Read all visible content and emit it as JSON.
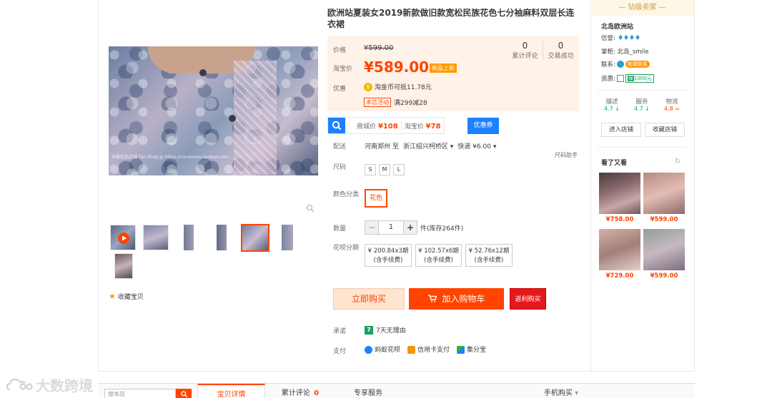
{
  "product": {
    "title": "欧洲站夏装女2019新款做旧款宽松民族花色七分袖麻料双层长连衣裙",
    "image_watermark": "天猫优品店铺 Tao-Shop.jp  https://cocomoco.taobao.com"
  },
  "price": {
    "price_label": "价格",
    "old_price": "¥599.00",
    "taobao_label": "淘宝价",
    "now_price": "¥589.00",
    "new_tag": "新品上新",
    "review_count": "0",
    "review_label": "累计评论",
    "deal_count": "0",
    "deal_label": "交易成功",
    "promo_label": "优惠",
    "coin_text": "淘金币可抵11.78元",
    "shop_activity": "本店活动",
    "shop_activity_text": "满299减28"
  },
  "mall": {
    "mall_price_label": "商城价",
    "mall_price": "¥108",
    "taobao_price_label": "淘宝价",
    "taobao_price": "¥78",
    "coupon_button": "优惠券"
  },
  "shipping": {
    "label": "配送",
    "from": "河南郑州 至",
    "to": "浙江绍兴柯桥区",
    "express": "快递 ¥6.00",
    "size_helper": "尺码助手"
  },
  "options": {
    "size_label": "尺码",
    "sizes": [
      "S",
      "M",
      "L"
    ],
    "color_label": "颜色分类",
    "color_selected": "花色",
    "qty_label": "数量",
    "qty_value": "1",
    "stock_text": "件(库存264件)",
    "installment_label": "花呗分期",
    "installments": [
      {
        "line1": "¥ 200.84x3期",
        "line2": "(含手续费)"
      },
      {
        "line1": "¥ 102.57x6期",
        "line2": "(含手续费)"
      },
      {
        "line1": "¥ 52.76x12期",
        "line2": "(含手续费)"
      }
    ]
  },
  "actions": {
    "buy_now": "立即购买",
    "add_cart": "加入购物车",
    "cashback": "返利购买"
  },
  "service": {
    "promise_label": "承诺",
    "promise_icon": "7",
    "promise_text": "7天无理由",
    "pay_label": "支付",
    "pay_methods": [
      "蚂蚁花呗",
      "信用卡支付",
      "集分宝"
    ]
  },
  "seller": {
    "header": "钻级卖家",
    "shop_name": "北岛欧洲站",
    "credit_label": "信誉:",
    "credit_icons": "♦♦♦♦",
    "keeper_label": "掌柜:",
    "keeper": "北岛_smile",
    "contact_label": "联系:",
    "contact": "和我联系",
    "qual_label": "资质:",
    "qual_value": "1000元",
    "scores": [
      {
        "name": "描述",
        "value": "4.7 ↓"
      },
      {
        "name": "服务",
        "value": "4.7 ↓"
      },
      {
        "name": "物流",
        "value": "4.8 ="
      }
    ],
    "enter_shop": "进入店铺",
    "fav_shop": "收藏店铺",
    "also_viewed": "看了又看",
    "recommend_prices": [
      "¥758.00",
      "¥599.00",
      "¥729.00",
      "¥599.00"
    ]
  },
  "gallery": {
    "fav_text": "收藏宝贝"
  },
  "bottom": {
    "search_placeholder": "搜本店",
    "tabs": [
      "宝贝详情",
      "累计评论",
      "专享服务",
      "手机购买"
    ],
    "review_count": "0"
  },
  "watermark": "大数跨境"
}
